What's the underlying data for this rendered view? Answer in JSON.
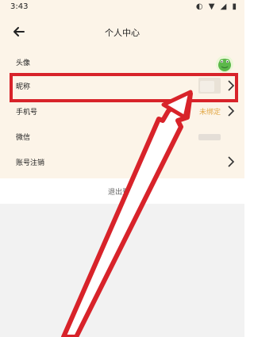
{
  "status": {
    "time": "3:43",
    "icons": "◐ ▼ ◢ ▮"
  },
  "header": {
    "title": "个人中心"
  },
  "rows": [
    {
      "label": "头像"
    },
    {
      "label": "昵称"
    },
    {
      "label": "手机号",
      "value": "未绑定"
    },
    {
      "label": "微信"
    },
    {
      "label": "账号注销"
    }
  ],
  "logout": {
    "label": "退出登录"
  },
  "colors": {
    "header_bg": "#FCF4E8",
    "accent": "#D8232A",
    "phone_value": "#E2A848"
  }
}
